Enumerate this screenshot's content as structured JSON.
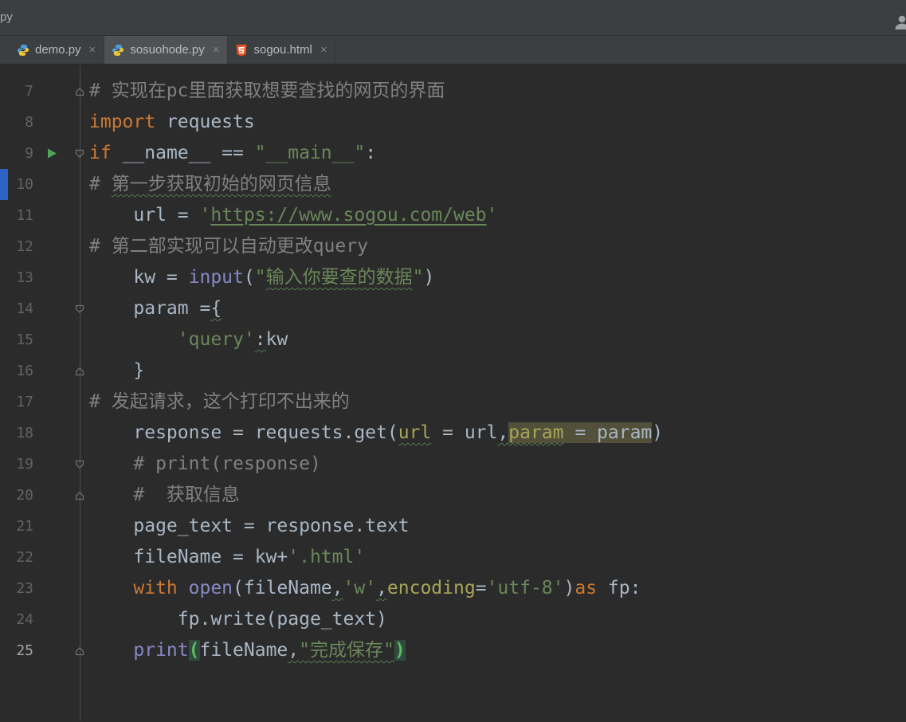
{
  "window": {
    "title_fragment": "py",
    "user_icon": "user-icon"
  },
  "tabs": [
    {
      "label": "demo.py",
      "icon": "python-icon",
      "close_icon": "close-icon",
      "active": false
    },
    {
      "label": "sosuohode.py",
      "icon": "python-icon",
      "close_icon": "close-icon",
      "active": true
    },
    {
      "label": "sogou.html",
      "icon": "html-icon",
      "close_icon": "close-icon",
      "active": false
    }
  ],
  "editor": {
    "language": "python",
    "first_line_number": 7,
    "last_line_number": 25,
    "lines": [
      {
        "no": 7,
        "marker": "up",
        "tokens": [
          [
            "c",
            "# 实现在pc里面获取想要查找的网页的界面"
          ]
        ]
      },
      {
        "no": 8,
        "tokens": [
          [
            "k",
            "import"
          ],
          [
            "d",
            " requests"
          ]
        ]
      },
      {
        "no": 9,
        "marker": "down",
        "run": true,
        "tokens": [
          [
            "k",
            "if"
          ],
          [
            "d",
            " __name__ == "
          ],
          [
            "s",
            "\"__main__\""
          ],
          [
            "d",
            ":"
          ]
        ]
      },
      {
        "no": 10,
        "bookmark": true,
        "tokens": [
          [
            "c",
            "# "
          ],
          [
            "c w",
            "第一步获取初始的网页信息"
          ]
        ]
      },
      {
        "no": 11,
        "tokens": [
          [
            "d",
            "    url = "
          ],
          [
            "s",
            "'"
          ],
          [
            "s u",
            "https://www.sogou.com/web"
          ],
          [
            "s",
            "'"
          ]
        ]
      },
      {
        "no": 12,
        "tokens": [
          [
            "c",
            "# 第二部实现可以自动更改query"
          ]
        ]
      },
      {
        "no": 13,
        "tokens": [
          [
            "d",
            "    kw = "
          ],
          [
            "b",
            "input"
          ],
          [
            "d",
            "("
          ],
          [
            "s",
            "\""
          ],
          [
            "s w",
            "输入你要查的数据"
          ],
          [
            "s",
            "\""
          ],
          [
            "d",
            ")"
          ]
        ]
      },
      {
        "no": 14,
        "marker": "down",
        "tokens": [
          [
            "d",
            "    param ="
          ],
          [
            "d w",
            "{"
          ]
        ]
      },
      {
        "no": 15,
        "tokens": [
          [
            "d",
            "        "
          ],
          [
            "s",
            "'query'"
          ],
          [
            "d w",
            ":"
          ],
          [
            "d",
            "kw"
          ]
        ]
      },
      {
        "no": 16,
        "marker": "up",
        "tokens": [
          [
            "d",
            "    }"
          ]
        ]
      },
      {
        "no": 17,
        "tokens": [
          [
            "c",
            "# 发起请求，这个打印不出来的"
          ]
        ]
      },
      {
        "no": 18,
        "tokens": [
          [
            "d",
            "    response = requests.get("
          ],
          [
            "a w",
            "url"
          ],
          [
            "d",
            " = url"
          ],
          [
            "d w",
            ","
          ],
          [
            "a h w",
            "param"
          ],
          [
            "d h",
            " = param"
          ],
          [
            "d",
            ")"
          ]
        ]
      },
      {
        "no": 19,
        "marker": "down",
        "tokens": [
          [
            "d",
            "    "
          ],
          [
            "c",
            "# print(response)"
          ]
        ]
      },
      {
        "no": 20,
        "marker": "up",
        "tokens": [
          [
            "d",
            "    "
          ],
          [
            "c",
            "#  获取信息"
          ]
        ]
      },
      {
        "no": 21,
        "tokens": [
          [
            "d",
            "    page_text = response.text"
          ]
        ]
      },
      {
        "no": 22,
        "tokens": [
          [
            "d",
            "    fileName = kw+"
          ],
          [
            "s",
            "'.html'"
          ]
        ]
      },
      {
        "no": 23,
        "tokens": [
          [
            "d",
            "    "
          ],
          [
            "k",
            "with"
          ],
          [
            "d",
            " "
          ],
          [
            "b",
            "open"
          ],
          [
            "d",
            "(fileName"
          ],
          [
            "d w",
            ","
          ],
          [
            "s",
            "'w'"
          ],
          [
            "d w",
            ","
          ],
          [
            "a",
            "encoding"
          ],
          [
            "d",
            "="
          ],
          [
            "s",
            "'utf-8'"
          ],
          [
            "d",
            ")"
          ],
          [
            "k",
            "as"
          ],
          [
            "d",
            " fp:"
          ]
        ]
      },
      {
        "no": 24,
        "tokens": [
          [
            "d",
            "        fp.write(page_text)"
          ]
        ]
      },
      {
        "no": 25,
        "marker": "up",
        "active": true,
        "tokens": [
          [
            "d",
            "    "
          ],
          [
            "b",
            "print"
          ],
          [
            "m",
            "("
          ],
          [
            "d",
            "fileName"
          ],
          [
            "d w",
            ","
          ],
          [
            "s w",
            "\"完成保存\""
          ],
          [
            "m",
            ")"
          ]
        ]
      }
    ]
  },
  "colors": {
    "background": "#2b2b2b",
    "panel": "#3c3f41",
    "active_tab": "#4e5254",
    "default_text": "#a9b7c6",
    "keyword": "#cc7832",
    "string": "#6a8759",
    "builtin": "#8888c6",
    "comment": "#808080",
    "keyword_argument": "#a8a558",
    "occurrence_highlight": "#52503a",
    "matched_brace": "#5dba5d",
    "run_arrow": "#4fa45a",
    "bookmark_blue": "#2d63c5",
    "line_number": "#606366"
  }
}
